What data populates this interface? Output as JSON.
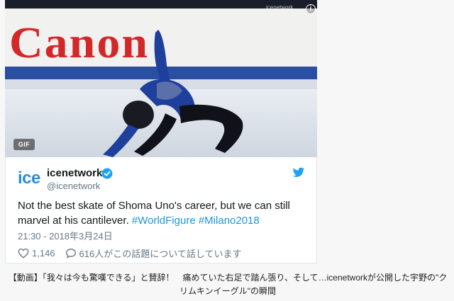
{
  "media": {
    "board_text": "Canon",
    "badge": "GIF",
    "watermark": "icenetwork",
    "info_label": "i"
  },
  "tweet": {
    "avatar_text": "ice",
    "display_name": "icenetwork",
    "handle": "@icenetwork",
    "text_main": "Not the best skate of Shoma Uno's career, but we can still marvel at his cantilever. ",
    "hashtag_1": "#WorldFigure",
    "hashtag_2": "#Milano2018",
    "timestamp": "21:30 - 2018年3月24日",
    "like_count": "1,146",
    "reply_text": "616人がこの話題について話しています"
  },
  "caption": "【動画】「我々は今も驚嘆できる」と賛辞！　痛めていた右足で踏ん張り、そして…icenetworkが公開した宇野の\"クリムキンイーグル\"の瞬間",
  "colors": {
    "brand_blue": "#1da1f2",
    "hashtag": "#1b95e0",
    "verified": "#1da1f2",
    "canon_red": "#d3282a"
  }
}
